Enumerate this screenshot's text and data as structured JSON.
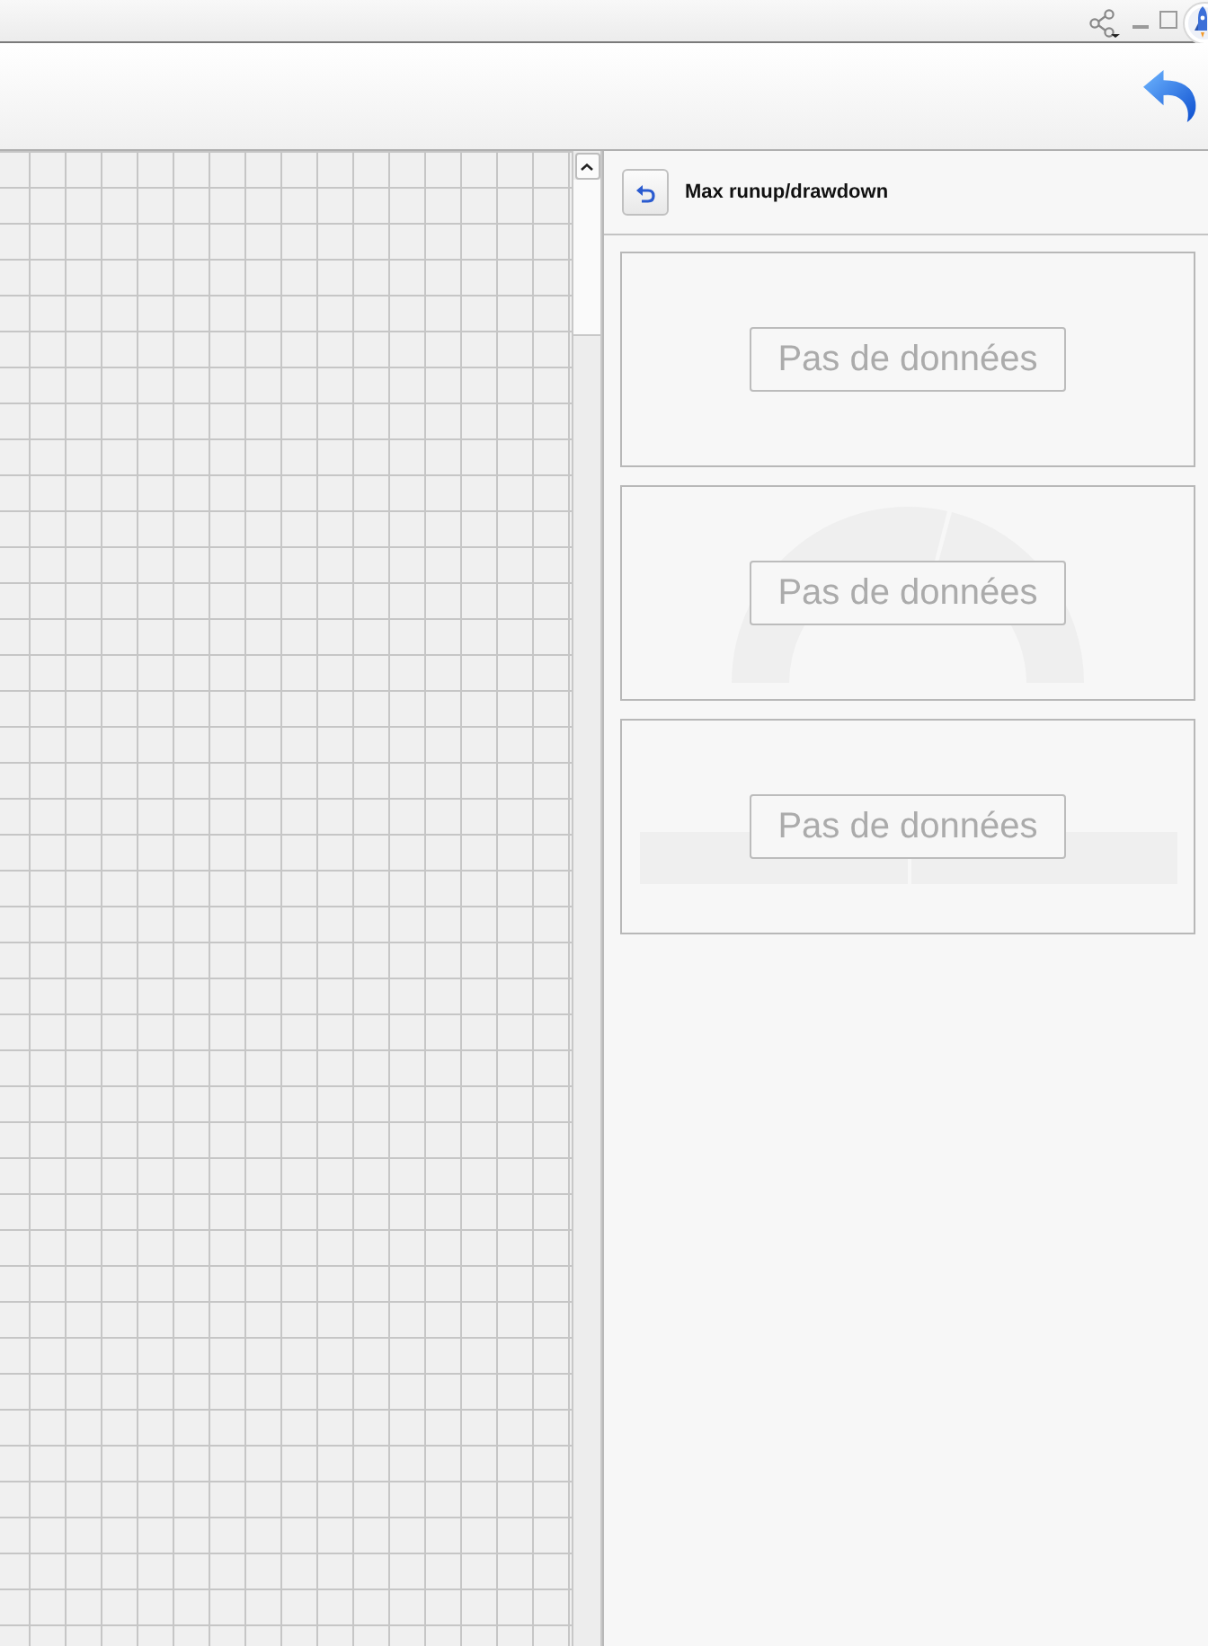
{
  "panel": {
    "title": "Max runup/drawdown"
  },
  "cards": [
    {
      "kind": "empty",
      "message": "Pas de données"
    },
    {
      "kind": "gauge",
      "message": "Pas de données"
    },
    {
      "kind": "bars",
      "message": "Pas de données"
    }
  ]
}
